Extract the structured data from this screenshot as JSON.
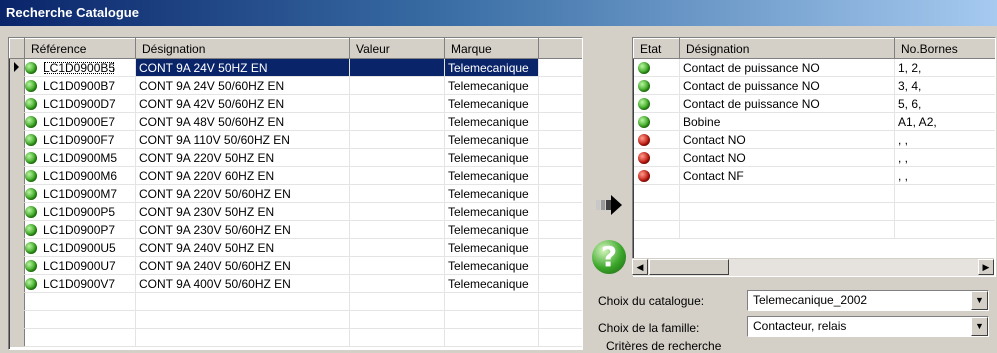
{
  "window": {
    "title": "Recherche Catalogue"
  },
  "left_grid": {
    "columns": [
      "Référence",
      "Désignation",
      "Valeur",
      "Marque"
    ],
    "selected_index": 0,
    "rows": [
      {
        "ref": "LC1D0900B5",
        "des": "CONT 9A 24V 50HZ EN",
        "val": "",
        "mar": "Telemecanique",
        "status": "green"
      },
      {
        "ref": "LC1D0900B7",
        "des": "CONT 9A 24V 50/60HZ EN",
        "val": "",
        "mar": "Telemecanique",
        "status": "green"
      },
      {
        "ref": "LC1D0900D7",
        "des": "CONT 9A 42V 50/60HZ EN",
        "val": "",
        "mar": "Telemecanique",
        "status": "green"
      },
      {
        "ref": "LC1D0900E7",
        "des": "CONT 9A 48V 50/60HZ EN",
        "val": "",
        "mar": "Telemecanique",
        "status": "green"
      },
      {
        "ref": "LC1D0900F7",
        "des": "CONT 9A 110V 50/60HZ EN",
        "val": "",
        "mar": "Telemecanique",
        "status": "green"
      },
      {
        "ref": "LC1D0900M5",
        "des": "CONT 9A 220V 50HZ EN",
        "val": "",
        "mar": "Telemecanique",
        "status": "green"
      },
      {
        "ref": "LC1D0900M6",
        "des": "CONT 9A 220V 60HZ EN",
        "val": "",
        "mar": "Telemecanique",
        "status": "green"
      },
      {
        "ref": "LC1D0900M7",
        "des": "CONT 9A 220V 50/60HZ EN",
        "val": "",
        "mar": "Telemecanique",
        "status": "green"
      },
      {
        "ref": "LC1D0900P5",
        "des": "CONT 9A 230V 50HZ EN",
        "val": "",
        "mar": "Telemecanique",
        "status": "green"
      },
      {
        "ref": "LC1D0900P7",
        "des": "CONT 9A 230V 50/60HZ EN",
        "val": "",
        "mar": "Telemecanique",
        "status": "green"
      },
      {
        "ref": "LC1D0900U5",
        "des": "CONT 9A 240V 50HZ EN",
        "val": "",
        "mar": "Telemecanique",
        "status": "green"
      },
      {
        "ref": "LC1D0900U7",
        "des": "CONT 9A 240V 50/60HZ EN",
        "val": "",
        "mar": "Telemecanique",
        "status": "green"
      },
      {
        "ref": "LC1D0900V7",
        "des": "CONT 9A 400V 50/60HZ EN",
        "val": "",
        "mar": "Telemecanique",
        "status": "green"
      },
      {
        "ref": "",
        "des": "",
        "val": "",
        "mar": "",
        "status": ""
      },
      {
        "ref": "",
        "des": "",
        "val": "",
        "mar": "",
        "status": ""
      },
      {
        "ref": "",
        "des": "",
        "val": "",
        "mar": "",
        "status": ""
      }
    ]
  },
  "right_grid": {
    "columns": [
      "Etat",
      "Désignation",
      "No.Bornes"
    ],
    "rows": [
      {
        "des": "Contact de puissance NO",
        "bornes": "1, 2,",
        "status": "green"
      },
      {
        "des": "Contact de puissance NO",
        "bornes": "3, 4,",
        "status": "green"
      },
      {
        "des": "Contact de puissance NO",
        "bornes": "5, 6,",
        "status": "green"
      },
      {
        "des": "Bobine",
        "bornes": "A1, A2,",
        "status": "green"
      },
      {
        "des": "Contact NO",
        "bornes": ", ,",
        "status": "red"
      },
      {
        "des": "Contact NO",
        "bornes": ", ,",
        "status": "red"
      },
      {
        "des": "Contact NF",
        "bornes": ", ,",
        "status": "red"
      },
      {
        "des": "",
        "bornes": "",
        "status": ""
      },
      {
        "des": "",
        "bornes": "",
        "status": ""
      },
      {
        "des": "",
        "bornes": "",
        "status": ""
      }
    ]
  },
  "help_symbol": "?",
  "form": {
    "catalogue_label": "Choix du catalogue:",
    "catalogue_value": "Telemecanique_2002",
    "famille_label": "Choix de la famille:",
    "famille_value": "Contacteur, relais",
    "criteria_label": "Critères de recherche"
  },
  "icons": {
    "status_ok": "green-dot-icon",
    "status_missing": "red-dot-icon",
    "transfer": "arrow-right-icon",
    "help": "help-icon"
  }
}
